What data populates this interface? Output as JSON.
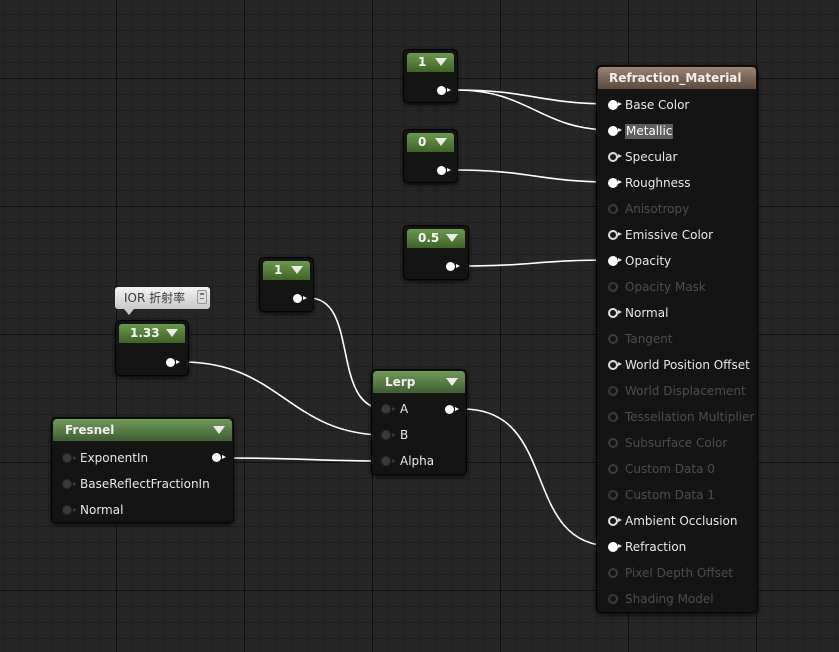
{
  "constants": [
    {
      "id": "const-base-color",
      "value": "1"
    },
    {
      "id": "const-roughness",
      "value": "0"
    },
    {
      "id": "const-opacity",
      "value": "0.5"
    },
    {
      "id": "const-lerp-a",
      "value": "1"
    },
    {
      "id": "const-ior",
      "value": "1.33"
    }
  ],
  "comment": {
    "text": "IOR 折射率"
  },
  "fresnel": {
    "title": "Fresnel",
    "inputs": [
      "ExponentIn",
      "BaseReflectFractionIn",
      "Normal"
    ]
  },
  "lerp": {
    "title": "Lerp",
    "inputs": [
      "A",
      "B",
      "Alpha"
    ]
  },
  "material": {
    "title": "Refraction_Material",
    "inputs": [
      {
        "label": "Base Color",
        "state": "connected"
      },
      {
        "label": "Metallic",
        "state": "connected",
        "highlighted": true
      },
      {
        "label": "Specular",
        "state": "available"
      },
      {
        "label": "Roughness",
        "state": "connected"
      },
      {
        "label": "Anisotropy",
        "state": "disabled"
      },
      {
        "label": "Emissive Color",
        "state": "available"
      },
      {
        "label": "Opacity",
        "state": "connected"
      },
      {
        "label": "Opacity Mask",
        "state": "disabled"
      },
      {
        "label": "Normal",
        "state": "available"
      },
      {
        "label": "Tangent",
        "state": "disabled"
      },
      {
        "label": "World Position Offset",
        "state": "available"
      },
      {
        "label": "World Displacement",
        "state": "disabled"
      },
      {
        "label": "Tessellation Multiplier",
        "state": "disabled"
      },
      {
        "label": "Subsurface Color",
        "state": "disabled"
      },
      {
        "label": "Custom Data 0",
        "state": "disabled"
      },
      {
        "label": "Custom Data 1",
        "state": "disabled"
      },
      {
        "label": "Ambient Occlusion",
        "state": "available"
      },
      {
        "label": "Refraction",
        "state": "connected"
      },
      {
        "label": "Pixel Depth Offset",
        "state": "disabled"
      },
      {
        "label": "Shading Model",
        "state": "disabled"
      }
    ]
  },
  "colors": {
    "constant_header": "#4f7d35",
    "function_header": "#587f46",
    "material_header": "#7c6858",
    "wire": "#ffffff",
    "grid_bg": "#262626"
  }
}
